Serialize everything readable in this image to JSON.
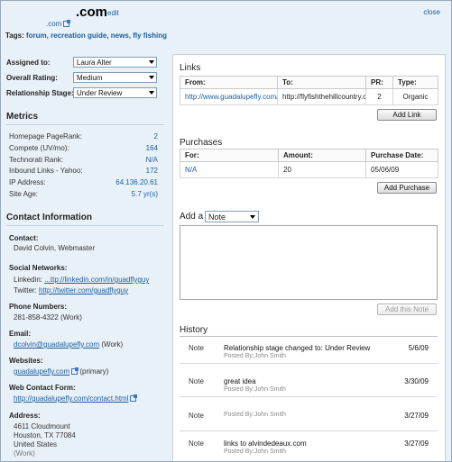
{
  "header": {
    "domain_suffix": ".com",
    "edit_label": "edit",
    "close_label": "close",
    "domain_small": ".com",
    "tags_label": "Tags:",
    "tags": "forum, recreation guide, news, fly fishing"
  },
  "fields": {
    "assigned_label": "Assigned to:",
    "assigned_value": "Laura Alter",
    "rating_label": "Overall Rating:",
    "rating_value": "Medium",
    "stage_label": "Relationship Stage:",
    "stage_value": "Under Review"
  },
  "metrics": {
    "title": "Metrics",
    "items": [
      {
        "label": "Homepage PageRank:",
        "value": "2"
      },
      {
        "label": "Compete (UV/mo):",
        "value": "164"
      },
      {
        "label": "Technorati Rank:",
        "value": "N/A"
      },
      {
        "label": "Inbound Links - Yahoo:",
        "value": "172"
      },
      {
        "label": "IP Address:",
        "value": "64.136.20.61"
      },
      {
        "label": "Site Age:",
        "value": "5.7 yr(s)"
      }
    ]
  },
  "contact": {
    "title": "Contact Information",
    "contact_label": "Contact:",
    "contact_value": "David Colvin, Webmaster",
    "social_label": "Social Networks:",
    "linkedin_label": "Linkedin:",
    "linkedin_value": "...ttp://linkedin.com/in/guadflyguy",
    "twitter_label": "Twitter:",
    "twitter_value": "http://twitter.com/guadflyguy",
    "phone_label": "Phone Numbers:",
    "phone_value": "281-858-4322",
    "phone_type": "(Work)",
    "email_label": "Email:",
    "email_value": "dcolvin@guadalupefly.com",
    "email_type": "(Work)",
    "websites_label": "Websites:",
    "website_value": "guadalupefly.com",
    "website_type": "(primary)",
    "form_label": "Web Contact Form:",
    "form_value": "http://guadalupefly.com/contact.html",
    "address_label": "Address:",
    "address_line1": "4611 Cloudmount",
    "address_line2": "Houston, TX 77084",
    "address_line3": "United States",
    "address_type": "(Work)"
  },
  "links": {
    "title": "Links",
    "headers": [
      "From:",
      "To:",
      "PR:",
      "Type:"
    ],
    "rows": [
      {
        "from": "http://www.guadalupefly.com/h",
        "to": "http://flyfishthehillcountry.co",
        "pr": "2",
        "type": "Organic"
      }
    ],
    "add_label": "Add Link"
  },
  "purchases": {
    "title": "Purchases",
    "headers": [
      "For:",
      "Amount:",
      "Purchase Date:"
    ],
    "rows": [
      {
        "for": "N/A",
        "amount": "20",
        "date": "05/06/09"
      }
    ],
    "add_label": "Add Purchase"
  },
  "note": {
    "add_a_label": "Add a",
    "type_value": "Note",
    "add_label": "Add this Note"
  },
  "history": {
    "title": "History",
    "items": [
      {
        "type": "Note",
        "message": "Relationship stage changed to: Under Review",
        "by": "Posted By:John Smith",
        "date": "5/6/09"
      },
      {
        "type": "Note",
        "message": "great idea",
        "by": "Posted By:John Smith",
        "date": "3/30/09"
      },
      {
        "type": "Note",
        "message": "",
        "by": "Posted By:John Smith",
        "date": "3/27/09"
      },
      {
        "type": "Note",
        "message": "links to alvindedeaux.com",
        "by": "Posted By:John Smith",
        "date": "3/27/09"
      }
    ]
  }
}
